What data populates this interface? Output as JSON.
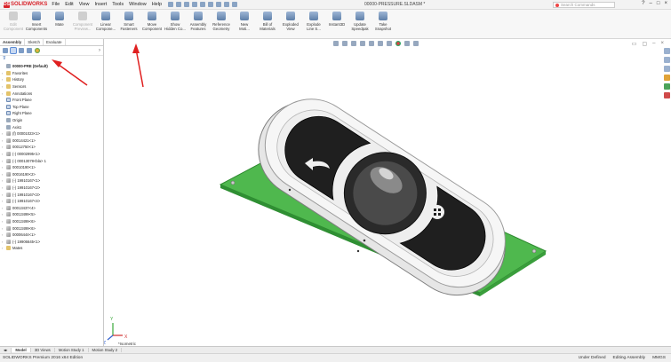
{
  "app": {
    "logo_text": "SOLIDWORKS",
    "document_title": "00000-PRESSURE.SLDASM *"
  },
  "menu": [
    "File",
    "Edit",
    "View",
    "Insert",
    "Tools",
    "Window",
    "Help"
  ],
  "search": {
    "placeholder": "Search Commands"
  },
  "window_controls": [
    "?",
    "–",
    "□",
    "×"
  ],
  "ribbon": [
    {
      "label": "Edit\nComponent",
      "icon": "edit-component-icon",
      "disabled": true
    },
    {
      "label": "Insert\nComponents",
      "icon": "insert-components-icon"
    },
    {
      "label": "Mate",
      "icon": "mate-icon"
    },
    {
      "label": "Component\nPreview...",
      "icon": "component-preview-icon",
      "disabled": true
    },
    {
      "label": "Linear\nCompone...",
      "icon": "linear-pattern-icon"
    },
    {
      "label": "Smart\nFasteners",
      "icon": "smart-fasteners-icon"
    },
    {
      "label": "Move\nComponent",
      "icon": "move-component-icon"
    },
    {
      "label": "Show\nHidden Co...",
      "icon": "show-hidden-icon"
    },
    {
      "label": "Assembly\nFeatures",
      "icon": "assembly-features-icon"
    },
    {
      "label": "Reference\nGeometry",
      "icon": "reference-geometry-icon"
    },
    {
      "label": "New\nMoti...",
      "icon": "new-motion-study-icon"
    },
    {
      "label": "Bill of\nMaterials",
      "icon": "bill-of-materials-icon"
    },
    {
      "label": "Exploded\nView",
      "icon": "exploded-view-icon"
    },
    {
      "label": "Explode\nLine S...",
      "icon": "explode-line-sketch-icon"
    },
    {
      "label": "Instant3D",
      "icon": "instant3d-icon"
    },
    {
      "label": "Update\nSpeedpak",
      "icon": "update-speedpak-icon"
    },
    {
      "label": "Take\nSnapshot",
      "icon": "take-snapshot-icon"
    }
  ],
  "panel": {
    "tabs": [
      "Assembly",
      "Sketch",
      "Evaluate"
    ],
    "active_tab": "Assembly",
    "filter_icon": "filter-icon",
    "tree": [
      {
        "label": "00000-PRE (Default)",
        "type": "root",
        "expanded": true
      },
      {
        "label": "Favorites",
        "type": "folder"
      },
      {
        "label": "History",
        "type": "folder"
      },
      {
        "label": "Sensors",
        "type": "folder"
      },
      {
        "label": "Annotations",
        "type": "folder"
      },
      {
        "label": "Front Plane",
        "type": "plane"
      },
      {
        "label": "Top Plane",
        "type": "plane"
      },
      {
        "label": "Right Plane",
        "type": "plane"
      },
      {
        "label": "Origin",
        "type": "origin"
      },
      {
        "label": "Axis1",
        "type": "axis"
      },
      {
        "label": "(f) 00001023<1>",
        "type": "part"
      },
      {
        "label": "00014421<1>",
        "type": "part"
      },
      {
        "label": "00012750<1>",
        "type": "part"
      },
      {
        "label": "(-) 00002995<1>",
        "type": "part"
      },
      {
        "label": "(-) 00013078<bla> 1",
        "type": "part"
      },
      {
        "label": "00010190<1>",
        "type": "part"
      },
      {
        "label": "00016190<2>",
        "type": "part"
      },
      {
        "label": "(-) 19910167<1>",
        "type": "part"
      },
      {
        "label": "(-) 19910167<2>",
        "type": "part"
      },
      {
        "label": "(-) 19910167<3>",
        "type": "part"
      },
      {
        "label": "(-) 19910167<4>",
        "type": "part"
      },
      {
        "label": "00013437<4>",
        "type": "part"
      },
      {
        "label": "00013499<5>",
        "type": "part"
      },
      {
        "label": "00013499<6>",
        "type": "part"
      },
      {
        "label": "00013499<6>",
        "type": "part"
      },
      {
        "label": "00006444<1>",
        "type": "part"
      },
      {
        "label": "(-) 19906645<1>",
        "type": "part"
      },
      {
        "label": "Mates",
        "type": "folder"
      }
    ]
  },
  "bottom_tabs": [
    "Model",
    "3D Views",
    "Motion Study 1",
    "Motion Study 2"
  ],
  "active_bottom_tab": "Model",
  "status": {
    "left": "SOLIDWORKS Premium 2016 x64 Edition",
    "state": "Under Defined",
    "mode": "Editing Assembly",
    "units": "MMGS"
  },
  "triad": {
    "x": "X",
    "y": "Y",
    "z": "Z",
    "view_label": "*Isometric"
  },
  "colors": {
    "pcb": "#4fb84e",
    "annotation_arrow": "#e02020",
    "housing": "#f4f4f4",
    "button_dark": "#1e1e1e"
  }
}
